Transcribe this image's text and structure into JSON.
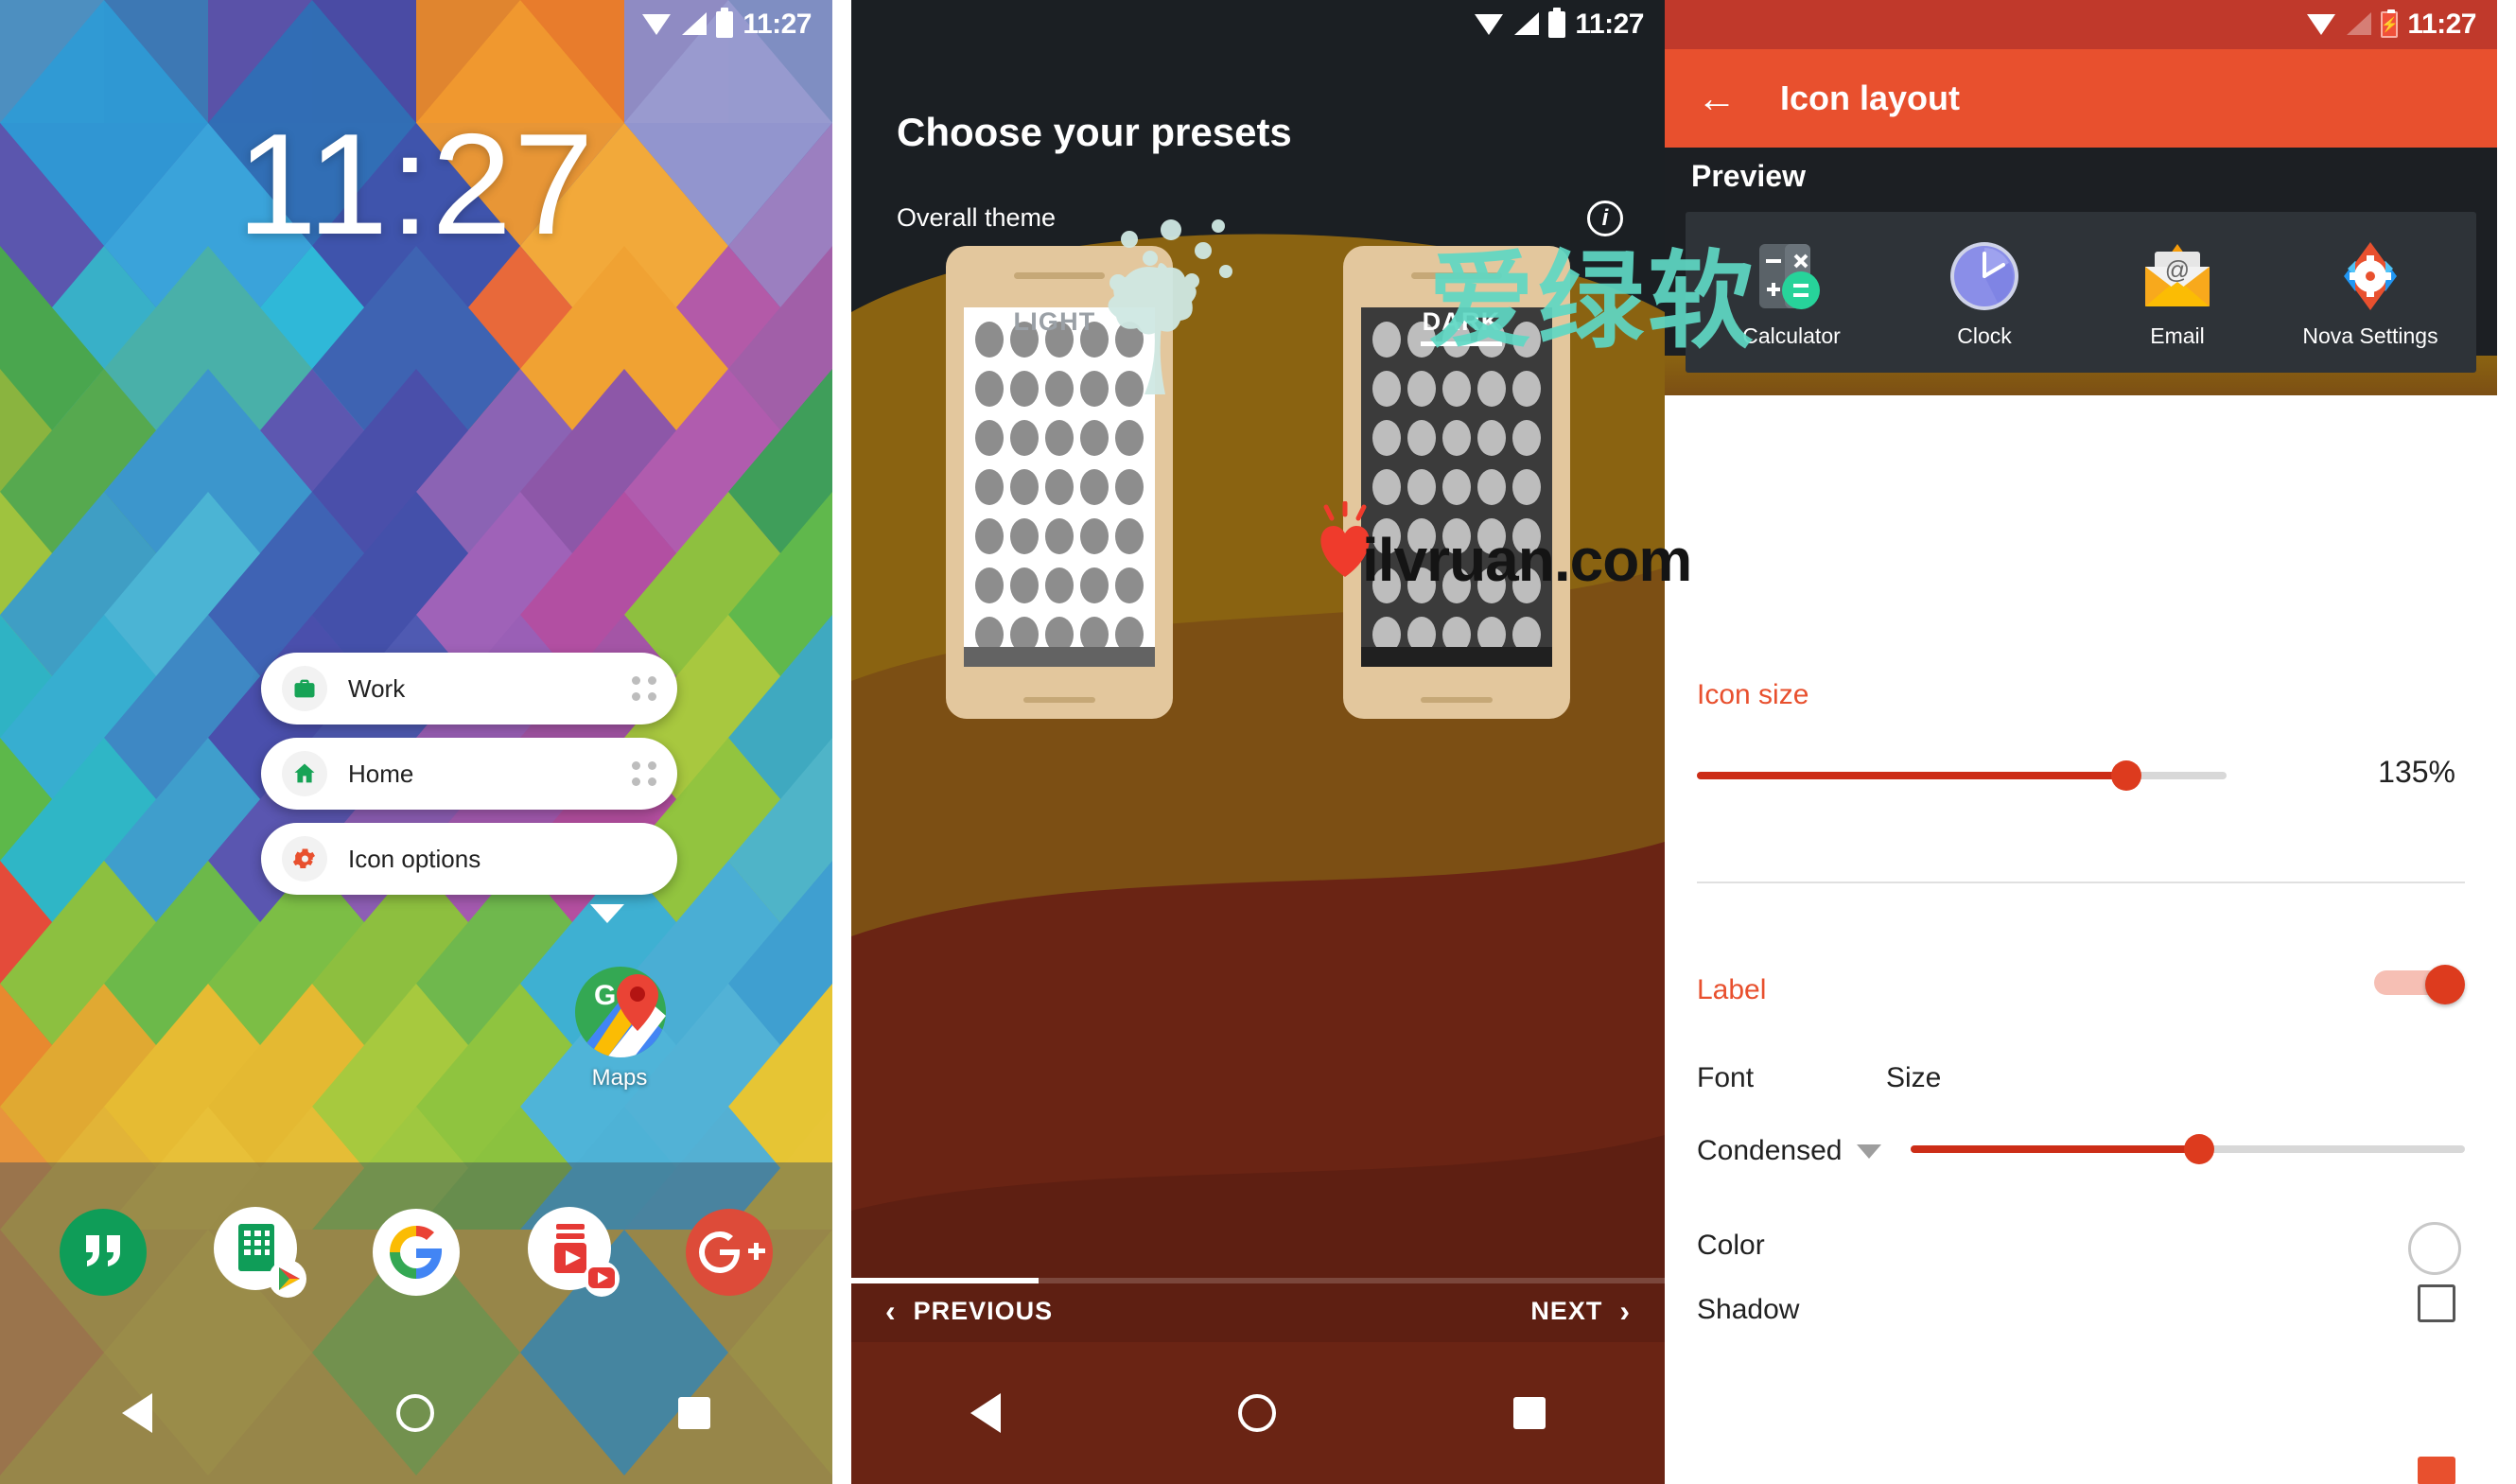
{
  "panel_home": {
    "status": {
      "time": "11:27",
      "icons": [
        "wifi-icon",
        "signal-icon",
        "battery-icon"
      ]
    },
    "clock_widget": "11:27",
    "shortcut_popup": {
      "items": [
        {
          "label": "Work",
          "icon": "briefcase-icon",
          "icon_color": "#17a356",
          "grip": "drag-handle-icon"
        },
        {
          "label": "Home",
          "icon": "house-icon",
          "icon_color": "#17a356",
          "grip": "drag-handle-icon"
        },
        {
          "label": "Icon options",
          "icon": "gear-icon",
          "icon_color": "#e8502e",
          "grip": ""
        }
      ]
    },
    "app_icon": {
      "label": "Maps",
      "icon": "google-maps-icon"
    },
    "page_indicator": "⌃",
    "dock": [
      {
        "name": "Hangouts",
        "icon": "hangouts-icon"
      },
      {
        "name": "Sheets",
        "icon": "google-sheets-icon"
      },
      {
        "name": "Google",
        "icon": "google-g-icon"
      },
      {
        "name": "Play Music",
        "icon": "youtube-play-icon"
      },
      {
        "name": "Google Plus",
        "icon": "google-plus-icon"
      }
    ],
    "navbar": [
      "back-icon",
      "home-icon",
      "recents-icon"
    ]
  },
  "panel_presets": {
    "status": {
      "time": "11:27"
    },
    "title": "Choose your presets",
    "subtitle": "Overall theme",
    "info_icon": "info-icon",
    "tabs": [
      {
        "label": "LIGHT",
        "selected": false
      },
      {
        "label": "DARK",
        "selected": true
      }
    ],
    "progress_percent": 23,
    "previous_label": "PREVIOUS",
    "next_label": "NEXT",
    "previous_icon": "chevron-left-icon",
    "next_icon": "chevron-right-icon",
    "navbar": [
      "back-icon",
      "home-icon",
      "recents-icon"
    ]
  },
  "panel_icon_layout": {
    "status": {
      "time": "11:27",
      "battery_state": "charging"
    },
    "back_icon": "arrow-left-icon",
    "title": "Icon layout",
    "preview": {
      "heading": "Preview",
      "apps": [
        {
          "label": "Calculator",
          "icon": "calculator-icon"
        },
        {
          "label": "Clock",
          "icon": "clock-icon"
        },
        {
          "label": "Email",
          "icon": "email-icon"
        },
        {
          "label": "Nova Settings",
          "icon": "nova-settings-icon"
        }
      ]
    },
    "settings": {
      "icon_size": {
        "label": "Icon size",
        "value": "135%",
        "slider_percent": 81
      },
      "label_toggle": {
        "label": "Label",
        "enabled": true
      },
      "font_header": "Font",
      "size_header": "Size",
      "font_value": "Condensed",
      "font_caret": "chevron-down-icon",
      "label_size_slider_percent": 52,
      "color": {
        "label": "Color",
        "swatch": "#ffffff"
      },
      "shadow": {
        "label": "Shadow",
        "checked": false
      },
      "single_line": {
        "label": "",
        "checked": true
      }
    },
    "accent_color": "#e8502e"
  },
  "watermark": {
    "cn_text": "爱绿软",
    "url_text": "ilvruan.com",
    "tree_icon": "tree-logo-icon",
    "heart_icon": "heart-icon"
  }
}
